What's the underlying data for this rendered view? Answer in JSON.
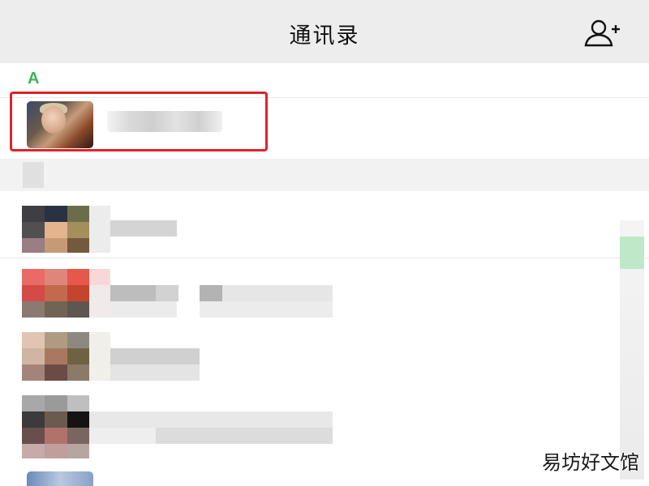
{
  "header": {
    "title": "通讯录",
    "add_contact_icon": "add-contact-icon"
  },
  "section": {
    "letter": "A"
  },
  "highlighted_contact": {
    "avatar_icon": "avatar-photo",
    "highlight_color": "#e0222b"
  },
  "watermark": "易坊好文馆",
  "colors": {
    "header_bg": "#ededed",
    "accent_green": "#3bb45a",
    "highlight_red": "#e0222b"
  }
}
